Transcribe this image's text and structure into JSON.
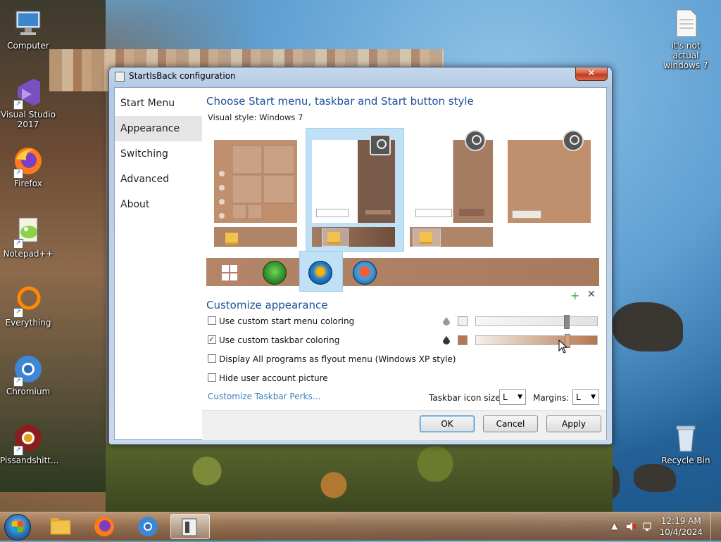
{
  "desktop": {
    "icons": [
      {
        "label": "Computer"
      },
      {
        "label": "Visual Studio 2017"
      },
      {
        "label": "Firefox"
      },
      {
        "label": "Notepad++"
      },
      {
        "label": "Everything"
      },
      {
        "label": "Chromium"
      },
      {
        "label": "Pissandshitt..."
      },
      {
        "label": "it's not actual windows 7"
      },
      {
        "label": "Recycle Bin"
      }
    ]
  },
  "window": {
    "title": "StartIsBack configuration",
    "close_glyph": "✕",
    "nav": [
      {
        "label": "Start Menu"
      },
      {
        "label": "Appearance"
      },
      {
        "label": "Switching"
      },
      {
        "label": "Advanced"
      },
      {
        "label": "About"
      }
    ],
    "style_heading": "Choose Start menu, taskbar and Start button style",
    "visual_style": "Visual style:  Windows 7",
    "customize_heading": "Customize appearance",
    "plus_glyph": "+",
    "remove_glyph": "✕",
    "options": [
      {
        "label": "Use custom start menu coloring",
        "checked": false
      },
      {
        "label": "Use custom taskbar coloring",
        "checked": true
      },
      {
        "label": "Display All programs as flyout menu (Windows XP style)",
        "checked": false
      },
      {
        "label": "Hide user account picture",
        "checked": false
      }
    ],
    "sliders": [
      {
        "level": 0.76,
        "swatch_color": "#f0f0f0"
      },
      {
        "level": 0.77,
        "swatch_color": "#b5774f"
      }
    ],
    "link": "Customize Taskbar Perks...",
    "icon_size_label": "Taskbar icon size:",
    "icon_size_value": "L",
    "margins_label": "Margins:",
    "margins_value": "L",
    "buttons": {
      "ok": "OK",
      "cancel": "Cancel",
      "apply": "Apply"
    }
  },
  "taskbar": {
    "time": "12:19 AM",
    "date": "10/4/2024",
    "tray_up": "▲"
  },
  "colors": {
    "accent_blue": "#1e4f9c",
    "taskbar_tint": "#b08468"
  }
}
